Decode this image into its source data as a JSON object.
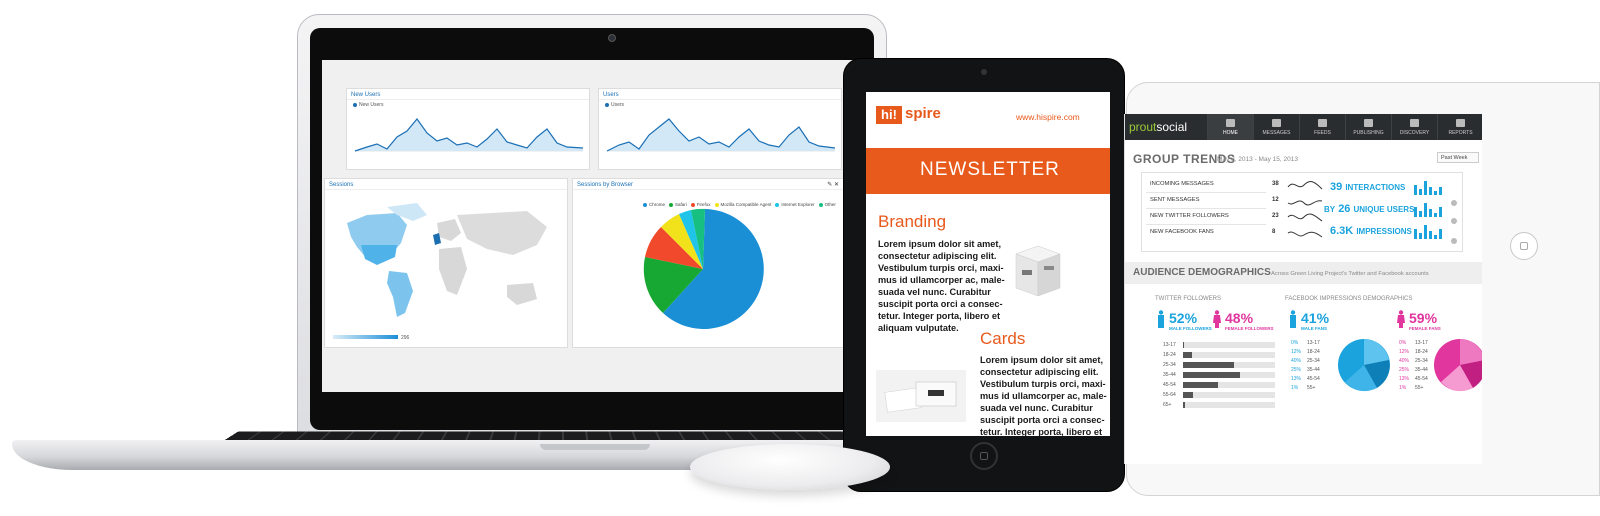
{
  "colors": {
    "hispire_orange": "#e8591c",
    "sprout_green": "#9acb3a",
    "blue": "#1ba3dd",
    "pink": "#e0369e"
  },
  "laptop": {
    "new_users_panel": {
      "title": "New Users",
      "legend": "New Users"
    },
    "users_panel": {
      "title": "Users",
      "legend": "Users"
    },
    "sessions_panel": {
      "title": "Sessions",
      "scale_min": "1",
      "scale_max": "296"
    },
    "browser_panel": {
      "title": "Sessions by Browser",
      "legend": [
        {
          "name": "Chrome",
          "color": "#1a8fd6"
        },
        {
          "name": "Safari",
          "color": "#16a832"
        },
        {
          "name": "Firefox",
          "color": "#f0492b"
        },
        {
          "name": "Mozilla Compatible Agent",
          "color": "#f1e21c"
        },
        {
          "name": "Internet Explorer",
          "color": "#1fc4e8"
        },
        {
          "name": "Other",
          "color": "#17c080"
        }
      ]
    }
  },
  "hispire": {
    "logo_box": "hi!",
    "logo_text": "spire",
    "url": "www.hispire.com",
    "banner": "NEWSLETTER",
    "section1_title": "Branding",
    "section1_text": "Lorem ipsum dolor sit amet, consectetur adipiscing elit. Vestibulum turpis orci, maxi-mus id ullamcorper ac, male-suada vel nunc. Curabitur suscipit porta orci a consec-tetur. Integer porta, libero et aliquam vulputate.",
    "section2_title": "Cards",
    "section2_text": "Lorem ipsum dolor sit amet, consectetur adipiscing elit. Vestibulum turpis orci, maxi-mus id ullamcorper ac, male-suada vel nunc. Curabitur suscipit porta orci a consec-tetur. Integer porta, libero et"
  },
  "sprout": {
    "logo_a": "prout",
    "logo_b": "social",
    "nav": [
      "HOME",
      "MESSAGES",
      "FEEDS",
      "PUBLISHING",
      "DISCOVERY",
      "REPORTS"
    ],
    "trends_title": "GROUP TRENDS",
    "trends_date": "May 8, 2013 - May 15, 2013",
    "period_select": "Past Week",
    "trend_rows": [
      {
        "label": "INCOMING MESSAGES",
        "value": "38"
      },
      {
        "label": "SENT MESSAGES",
        "value": "12"
      },
      {
        "label": "NEW TWITTER FOLLOWERS",
        "value": "23"
      },
      {
        "label": "NEW FACEBOOK FANS",
        "value": "8"
      }
    ],
    "interactions_value": "39",
    "interactions_label": "INTERACTIONS",
    "unique_users_prefix": "BY",
    "unique_users_value": "26",
    "unique_users_label": "UNIQUE USERS",
    "impressions_value": "6.3K",
    "impressions_label": "IMPRESSIONS",
    "demo_title": "AUDIENCE DEMOGRAPHICS",
    "demo_subtitle": "Across Green Living Project's Twitter and Facebook accounts",
    "twitter_followers_label": "TWITTER FOLLOWERS",
    "facebook_label": "FACEBOOK IMPRESSIONS DEMOGRAPHICS",
    "tw_male_pct": "52%",
    "tw_male_label": "MALE FOLLOWERS",
    "tw_female_pct": "48%",
    "tw_female_label": "FEMALE FOLLOWERS",
    "fb_male_pct": "41%",
    "fb_male_label": "MALE FANS",
    "fb_female_pct": "59%",
    "fb_female_label": "FEMALE FANS",
    "age_groups": [
      "13-17",
      "18-24",
      "25-34",
      "35-44",
      "45-54",
      "55-64",
      "65+"
    ],
    "twitter_age_fill": [
      0.01,
      0.1,
      0.55,
      0.62,
      0.38,
      0.11,
      0.02
    ],
    "fb_male_rows": [
      {
        "pct": "0%",
        "age": "13-17"
      },
      {
        "pct": "12%",
        "age": "18-24"
      },
      {
        "pct": "40%",
        "age": "25-34"
      },
      {
        "pct": "25%",
        "age": "35-44"
      },
      {
        "pct": "13%",
        "age": "45-54"
      },
      {
        "pct": "1%",
        "age": "55+"
      }
    ],
    "fb_female_rows": [
      {
        "pct": "0%",
        "age": "13-17"
      },
      {
        "pct": "12%",
        "age": "18-24"
      },
      {
        "pct": "40%",
        "age": "25-34"
      },
      {
        "pct": "25%",
        "age": "35-44"
      },
      {
        "pct": "13%",
        "age": "45-54"
      },
      {
        "pct": "1%",
        "age": "55+"
      }
    ]
  }
}
